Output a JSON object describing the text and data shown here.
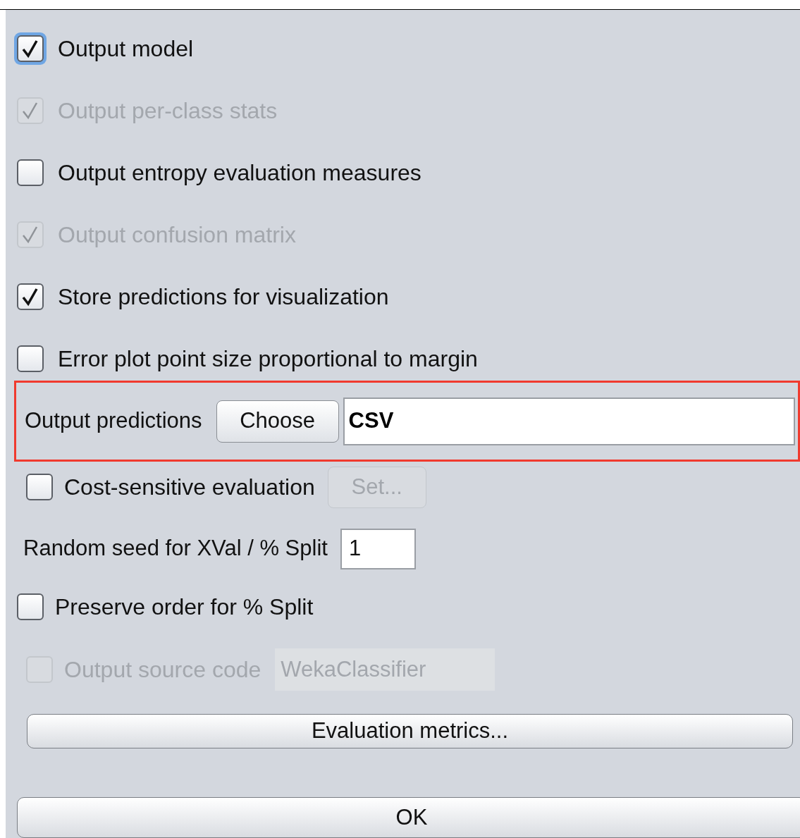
{
  "options": [
    {
      "label": "Output model",
      "checked": true,
      "disabled": false,
      "focused": true
    },
    {
      "label": "Output per-class stats",
      "checked": true,
      "disabled": true,
      "focused": false
    },
    {
      "label": "Output entropy evaluation measures",
      "checked": false,
      "disabled": false,
      "focused": false
    },
    {
      "label": "Output confusion matrix",
      "checked": true,
      "disabled": true,
      "focused": false
    },
    {
      "label": "Store predictions for visualization",
      "checked": true,
      "disabled": false,
      "focused": false
    },
    {
      "label": "Error plot point size proportional to margin",
      "checked": false,
      "disabled": false,
      "focused": false
    }
  ],
  "output_predictions": {
    "label": "Output predictions",
    "button": "Choose",
    "value": "CSV",
    "highlighted": true
  },
  "cost_sensitive": {
    "label": "Cost-sensitive evaluation",
    "checked": false,
    "disabled": false,
    "button": "Set...",
    "button_disabled": true
  },
  "random_seed": {
    "label": "Random seed for XVal / % Split",
    "value": "1"
  },
  "preserve_order": {
    "label": "Preserve order for % Split",
    "checked": false,
    "disabled": false
  },
  "source_code": {
    "label": "Output source code",
    "checked": false,
    "disabled": true,
    "value": "WekaClassifier"
  },
  "buttons": [
    "Evaluation metrics...",
    "OK"
  ]
}
